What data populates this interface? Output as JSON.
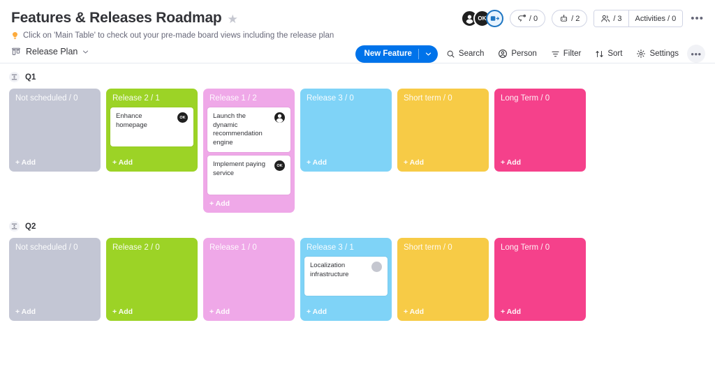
{
  "header": {
    "title": "Features & Releases Roadmap",
    "star_icon": "star-icon",
    "tip_icon": "lightbulb-icon",
    "subtitle": "Click on 'Main Table' to check out your pre-made board views including the release plan",
    "avatars": [
      {
        "initials": "",
        "icon": "person-icon"
      },
      {
        "initials": "OK",
        "icon": ""
      },
      {
        "initials": "",
        "icon": "invite-member-icon"
      }
    ],
    "stats": [
      {
        "name": "updates",
        "icon": "update-icon",
        "value": "/ 0"
      },
      {
        "name": "integrations",
        "icon": "robot-icon",
        "value": "/ 2"
      }
    ],
    "group_stats": [
      {
        "name": "members",
        "icon": "people-icon",
        "label": "/ 3"
      },
      {
        "name": "activities",
        "icon": "",
        "label": "Activities / 0"
      }
    ],
    "more_label": "•••"
  },
  "viewbar": {
    "view_icon": "kanban-board-icon",
    "view_name": "Release Plan",
    "chevron": "⌄",
    "new_button": {
      "label": "New Feature",
      "arrow": "⌄"
    },
    "tools": [
      {
        "name": "search",
        "icon": "search-icon",
        "label": "Search"
      },
      {
        "name": "person",
        "icon": "person-circle-icon",
        "label": "Person"
      },
      {
        "name": "filter",
        "icon": "filter-icon",
        "label": "Filter"
      },
      {
        "name": "sort",
        "icon": "sort-icon",
        "label": "Sort"
      },
      {
        "name": "settings",
        "icon": "gear-icon",
        "label": "Settings"
      }
    ],
    "more_label": "•••"
  },
  "colors": {
    "grey": "#c3c6d4",
    "green": "#9cd326",
    "pink": "#efa8e8",
    "blue": "#7fd3f7",
    "yellow": "#f7cb46",
    "magenta": "#f5418b",
    "accent": "#0073ea"
  },
  "add_label": "+ Add",
  "groups": [
    {
      "title": "Q1",
      "collapse_icon": "collapse-group-icon",
      "columns": [
        {
          "label": "Not scheduled / 0",
          "color": "#c3c6d4",
          "cards": []
        },
        {
          "label": "Release 2 / 1",
          "color": "#9cd326",
          "cards": [
            {
              "title": "Enhance homepage",
              "avatar": "OK",
              "avatar_type": "initials"
            }
          ]
        },
        {
          "label": "Release 1 / 2",
          "color": "#efa8e8",
          "cards": [
            {
              "title": "Launch the dynamic recommendation engine",
              "avatar": "",
              "avatar_type": "person"
            },
            {
              "title": "Implement paying service",
              "avatar": "OK",
              "avatar_type": "initials"
            }
          ]
        },
        {
          "label": "Release 3 / 0",
          "color": "#7fd3f7",
          "cards": []
        },
        {
          "label": "Short term / 0",
          "color": "#f7cb46",
          "cards": []
        },
        {
          "label": "Long Term / 0",
          "color": "#f5418b",
          "cards": []
        }
      ]
    },
    {
      "title": "Q2",
      "collapse_icon": "collapse-group-icon",
      "columns": [
        {
          "label": "Not scheduled / 0",
          "color": "#c3c6d4",
          "cards": []
        },
        {
          "label": "Release 2 / 0",
          "color": "#9cd326",
          "cards": []
        },
        {
          "label": "Release 1 / 0",
          "color": "#efa8e8",
          "cards": []
        },
        {
          "label": "Release 3 / 1",
          "color": "#7fd3f7",
          "cards": [
            {
              "title": "Localization infrastructure",
              "avatar": "",
              "avatar_type": "empty"
            }
          ]
        },
        {
          "label": "Short term / 0",
          "color": "#f7cb46",
          "cards": []
        },
        {
          "label": "Long Term / 0",
          "color": "#f5418b",
          "cards": []
        }
      ]
    }
  ]
}
